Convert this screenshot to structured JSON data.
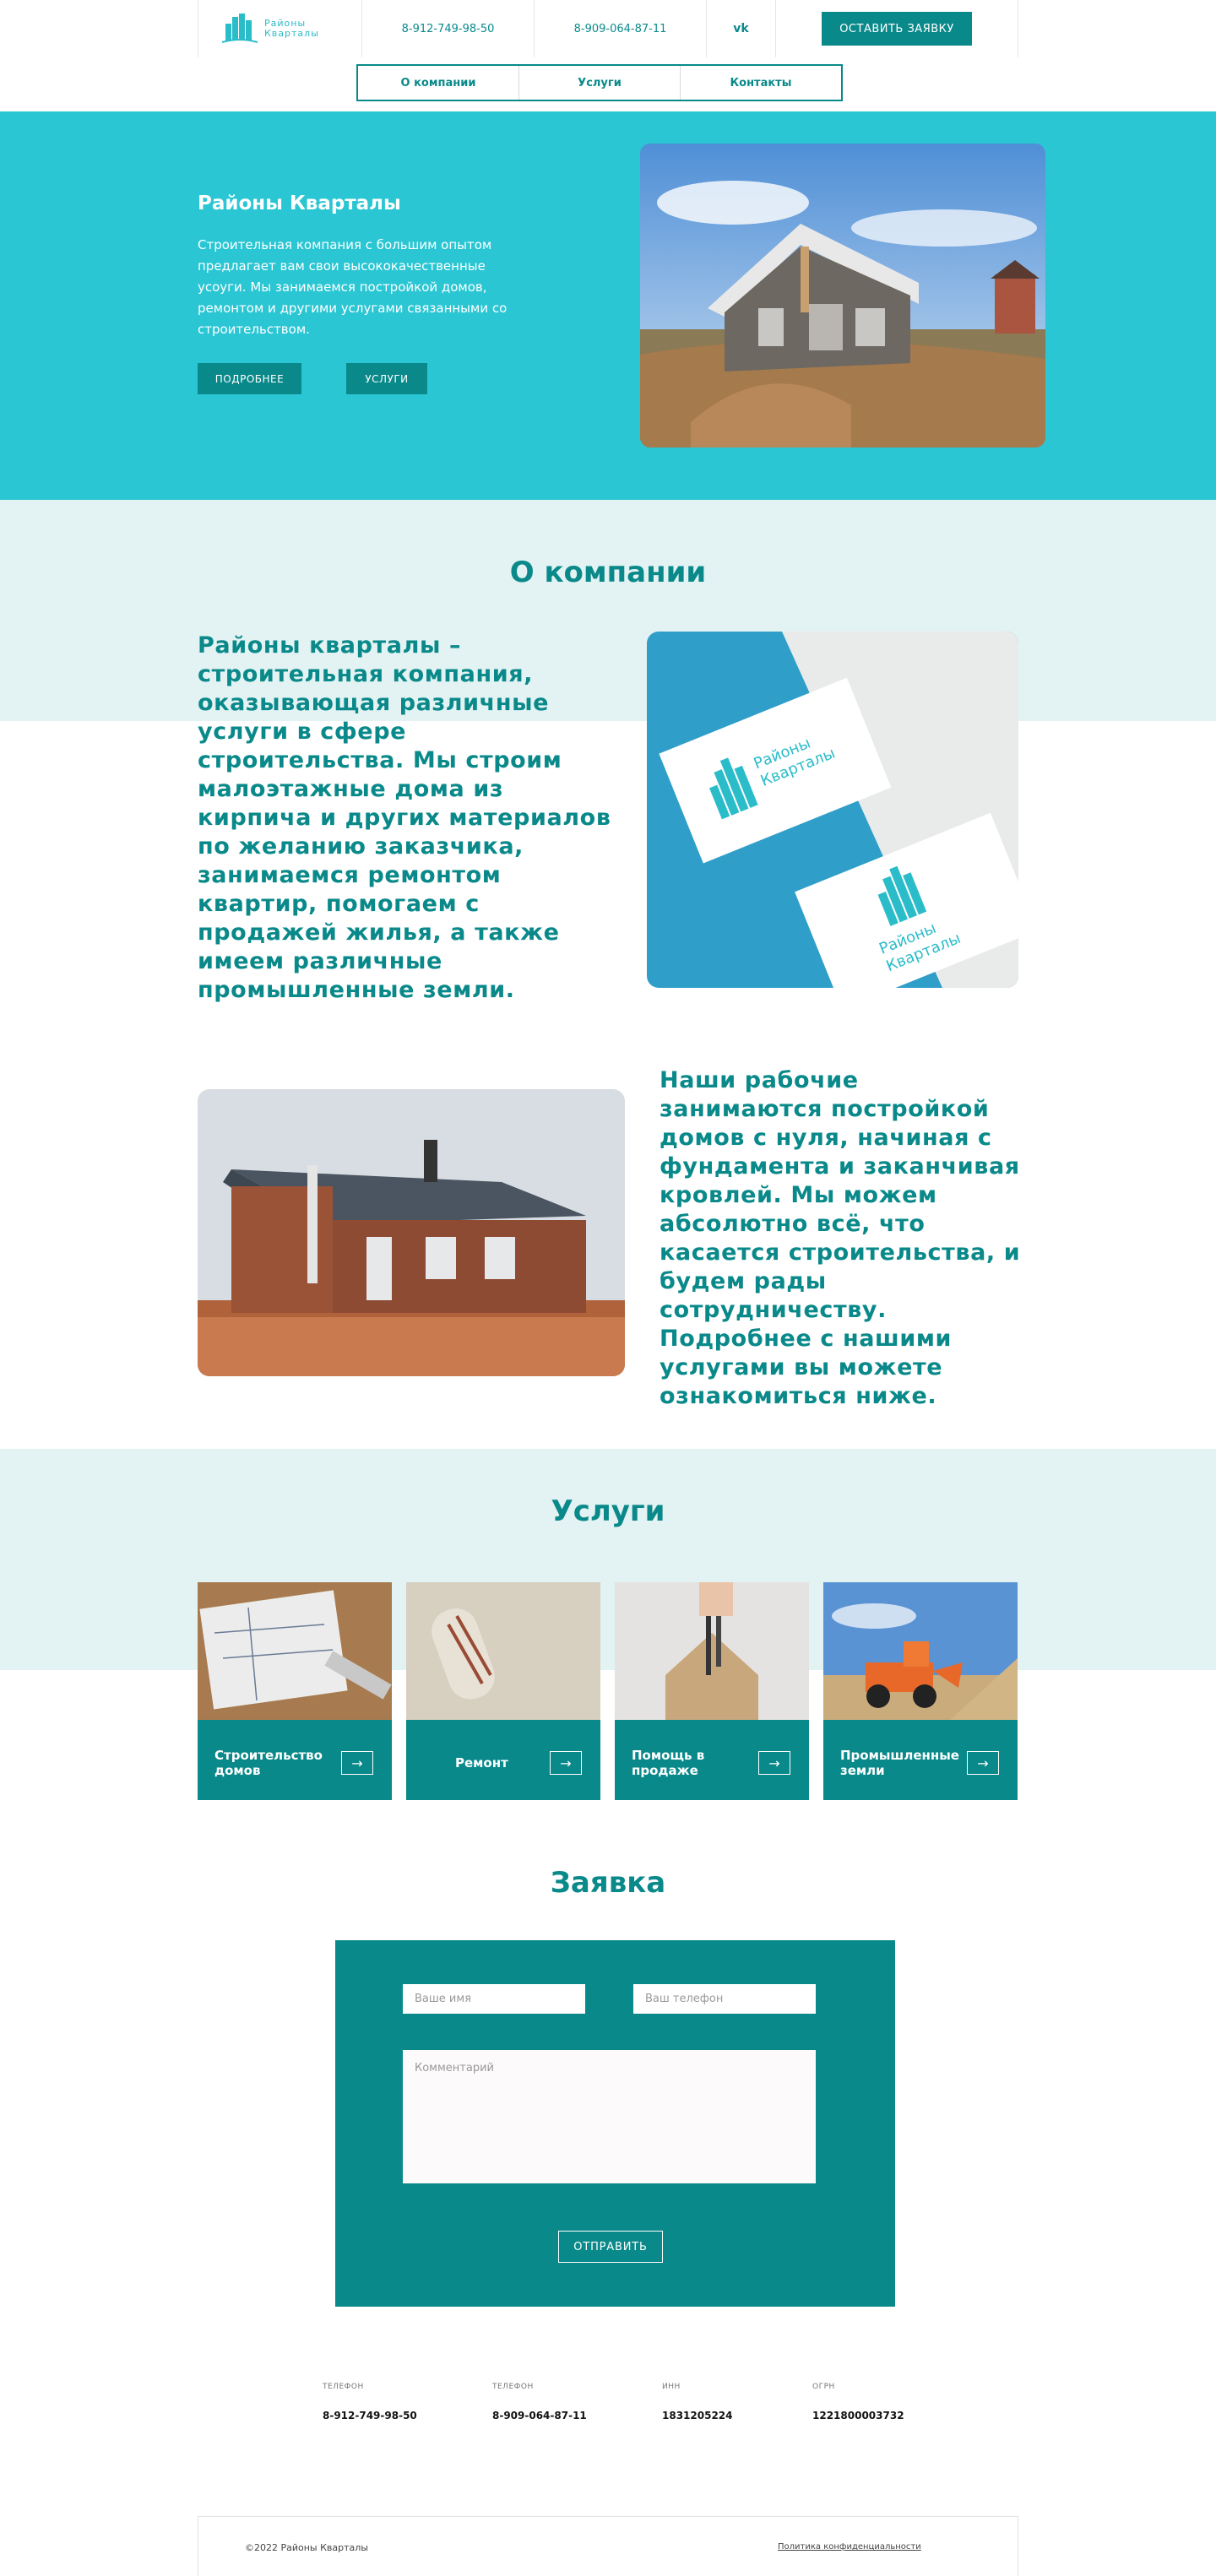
{
  "header": {
    "logo_line1": "Районы",
    "logo_line2": "Кварталы",
    "phone1": "8-912-749-98-50",
    "phone2": "8-909-064-87-11",
    "vk_icon": "vk-icon",
    "cta_label": "ОСТАВИТЬ ЗАЯВКУ"
  },
  "nav": [
    {
      "label": "О компании"
    },
    {
      "label": "Услуги"
    },
    {
      "label": "Контакты"
    }
  ],
  "hero": {
    "title": "Районы Кварталы",
    "text": "Строительная компания с большим опытом предлагает вам свои высококачественные усоуги. Мы занимаемся постройкой домов, ремонтом и другими услугами связанными со строительством.",
    "btn_more": "ПОДРОБНЕЕ",
    "btn_services": "УСЛУГИ"
  },
  "about": {
    "title": "О компании",
    "text1": "Районы кварталы – строительная компания, оказывающая различные услуги в сфере строительства. Мы строим малоэтажные дома из кирпича и других материалов по желанию заказчика, занимаемся ремонтом квартир, помогаем с продажей жилья, а также имеем различные промышленные земли.",
    "text2": "Наши рабочие занимаются постройкой домов с нуля, начиная с фундамента и заканчивая кровлей. Мы можем абсолютно всё, что касается строительства, и будем рады сотрудничеству. Подробнее с нашими услугами вы можете ознакомиться ниже.",
    "card_logo_line1": "Районы",
    "card_logo_line2": "Кварталы"
  },
  "services": {
    "title": "Услуги",
    "items": [
      {
        "label": "Строительство домов"
      },
      {
        "label": "Ремонт"
      },
      {
        "label": "Помощь в продаже"
      },
      {
        "label": "Промышленные земли"
      }
    ]
  },
  "form": {
    "title": "Заявка",
    "name_placeholder": "Ваше имя",
    "phone_placeholder": "Ваш телефон",
    "comment_placeholder": "Комментарий",
    "submit": "ОТПРАВИТЬ"
  },
  "info": [
    {
      "key": "ТЕЛЕФОН",
      "value": "8-912-749-98-50"
    },
    {
      "key": "ТЕЛЕФОН",
      "value": "8-909-064-87-11"
    },
    {
      "key": "ИНН",
      "value": "1831205224"
    },
    {
      "key": "ОГРН",
      "value": "1221800003732"
    }
  ],
  "footer": {
    "copyright": "©2022 Районы Кварталы",
    "privacy": "Политика конфиденциальности"
  },
  "colors": {
    "teal": "#0a898a",
    "cyan": "#2ac6d3",
    "light": "#e3f2f2"
  }
}
